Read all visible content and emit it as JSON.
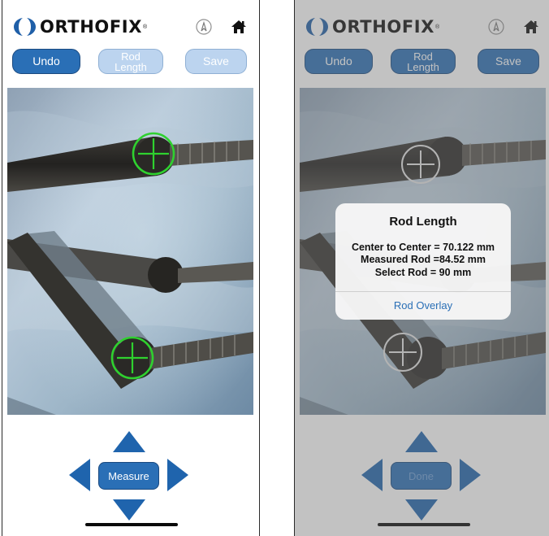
{
  "brand": {
    "name": "ORTHOFIX",
    "reg": "®"
  },
  "colors": {
    "accent": "#2a6fb6",
    "accent_disabled": "#bcd4ef",
    "marker_active": "#2fd12f",
    "marker_inactive": "#e6e6e6",
    "dialog_link": "#2a6fb6"
  },
  "icons": {
    "nav_compass": "compass-icon",
    "nav_home": "home-icon",
    "arrows": [
      "arrow-up-icon",
      "arrow-down-icon",
      "arrow-left-icon",
      "arrow-right-icon"
    ]
  },
  "left_screen": {
    "toolbar": {
      "undo": "Undo",
      "rod_length": "Rod\nLength",
      "save": "Save",
      "undo_enabled": true,
      "rod_length_enabled": false,
      "save_enabled": false
    },
    "center_button": "Measure"
  },
  "right_screen": {
    "toolbar": {
      "undo": "Undo",
      "rod_length": "Rod\nLength",
      "save": "Save"
    },
    "center_button": "Done",
    "dialog": {
      "title": "Rod Length",
      "center_to_center": "Center to Center = 70.122 mm",
      "measured_rod": "Measured Rod =84.52 mm",
      "select_rod": "Select Rod = 90 mm",
      "action": "Rod Overlay"
    }
  }
}
